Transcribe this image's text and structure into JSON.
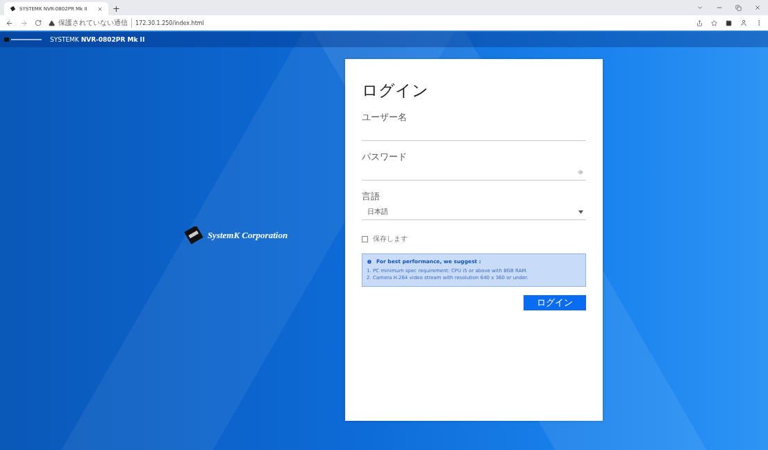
{
  "browser": {
    "tab_title": "SYSTEMK NVR-0802PR Mk II",
    "new_tab": "+",
    "security_warning": "保護されていない通信",
    "url": "172.30.1.250/index.html"
  },
  "header": {
    "title": "SYSTEMK **NVR-0802PR Mk II**"
  },
  "brand": {
    "name": "SystemK Corporation"
  },
  "login": {
    "title": "ログイン",
    "fields": [
      {
        "kind": "text",
        "label": "ユーザー名"
      },
      {
        "kind": "password",
        "label": "パスワード"
      },
      {
        "kind": "select",
        "label": "言語",
        "value": "日本語"
      }
    ],
    "remember": {
      "label": "保存します",
      "checked": false
    },
    "notice": {
      "title": "For best performance, we suggest :",
      "lines": [
        "1. PC minimum spec requirement: CPU i5 or above with 8GB RAM.",
        "2. Camera H.264 video stream with resolution 640 x 360 or under."
      ]
    },
    "submit": "ログイン"
  }
}
